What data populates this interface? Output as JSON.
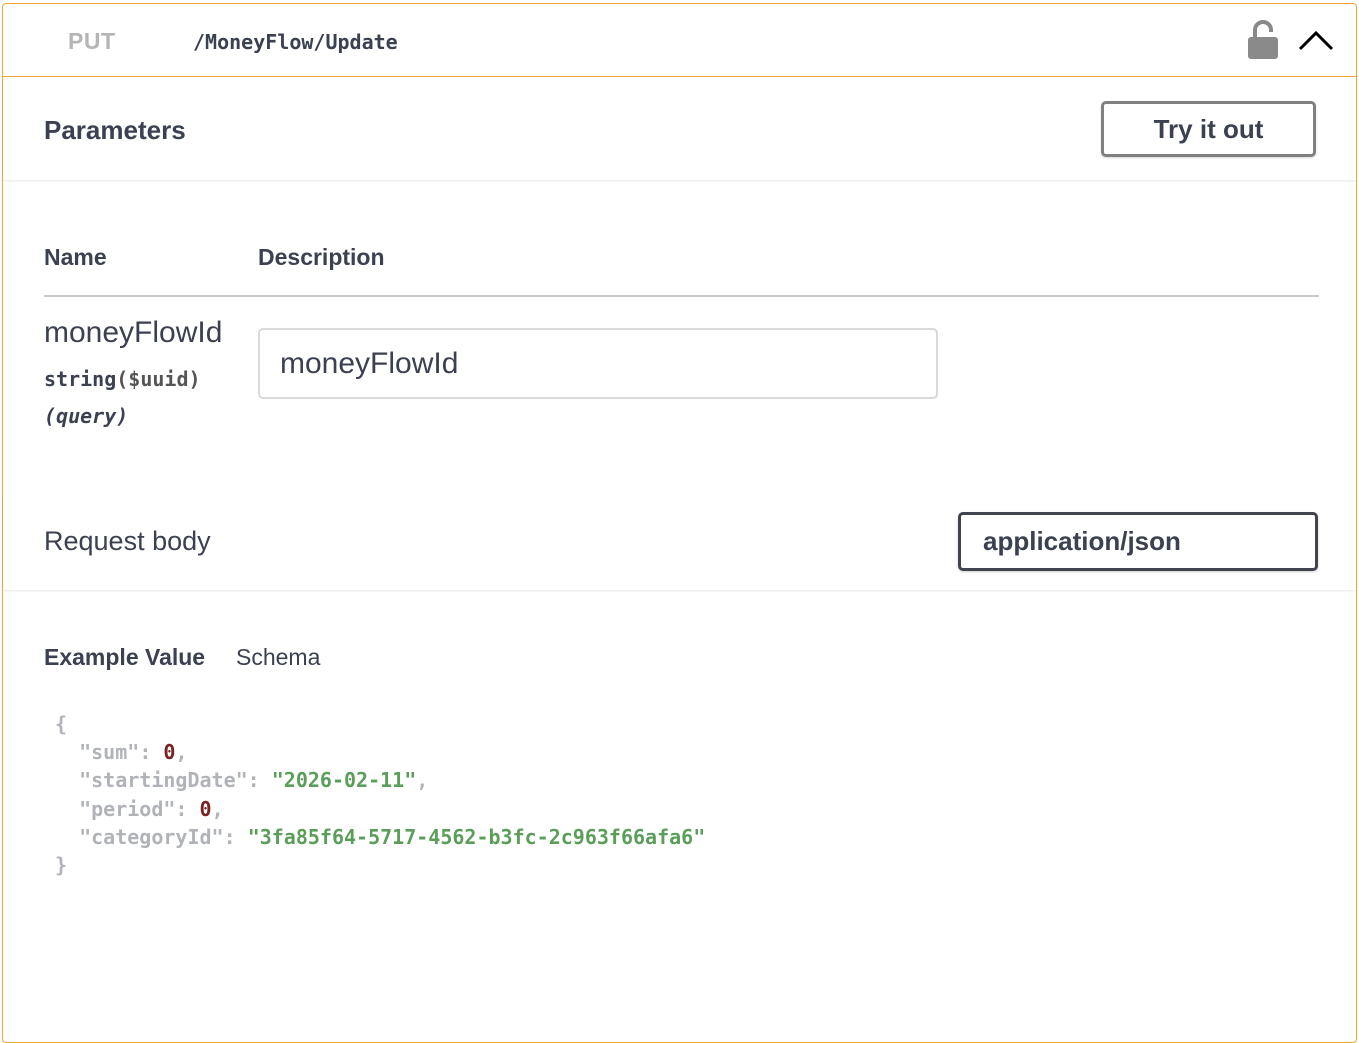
{
  "operation": {
    "method": "PUT",
    "path": "/MoneyFlow/Update",
    "lock_icon": "unlocked-lock-icon",
    "collapse_icon": "chevron-up-icon"
  },
  "parameters_section": {
    "title": "Parameters",
    "try_button": "Try it out",
    "columns": {
      "name": "Name",
      "description": "Description"
    },
    "params": [
      {
        "name": "moneyFlowId",
        "type": "string",
        "format": "($uuid)",
        "in": "(query)",
        "placeholder": "moneyFlowId"
      }
    ]
  },
  "request_body": {
    "title": "Request body",
    "content_type": "application/json"
  },
  "example": {
    "tab_example": "Example Value",
    "tab_schema": "Schema",
    "open_brace": "{",
    "close_brace": "}",
    "fields": [
      {
        "key": "\"sum\"",
        "value": "0",
        "kind": "num",
        "trail": ","
      },
      {
        "key": "\"startingDate\"",
        "value": "\"2026-02-11\"",
        "kind": "str",
        "trail": ","
      },
      {
        "key": "\"period\"",
        "value": "0",
        "kind": "num",
        "trail": ","
      },
      {
        "key": "\"categoryId\"",
        "value": "\"3fa85f64-5717-4562-b3fc-2c963f66afa6\"",
        "kind": "str",
        "trail": ""
      }
    ]
  },
  "colors": {
    "accent_put": "#fca130",
    "border": "#f3a638",
    "text": "#3b4151",
    "json_number": "#7a2323",
    "json_string": "#5a9e5a",
    "json_punct": "#b0b3b8"
  }
}
